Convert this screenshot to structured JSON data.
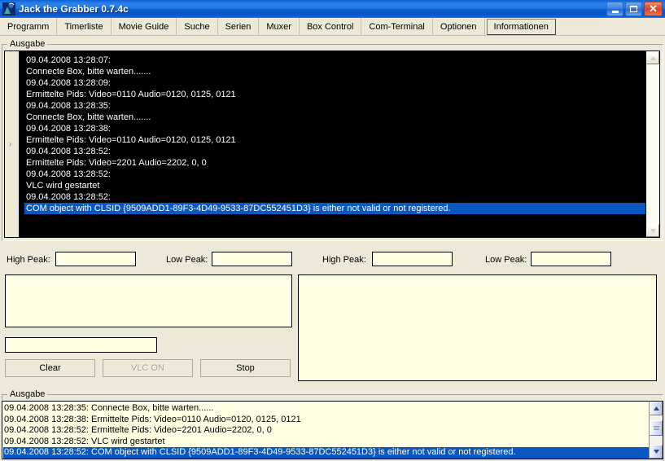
{
  "window": {
    "title": "Jack the Grabber 0.7.4c",
    "icon": "app-icon",
    "caption_buttons": [
      {
        "name": "minimize",
        "glyph": "minimize-icon"
      },
      {
        "name": "maximize",
        "glyph": "maximize-icon"
      },
      {
        "name": "close",
        "glyph": "close-icon",
        "label": "✕"
      }
    ]
  },
  "menu": {
    "items": [
      {
        "label": "Programm",
        "selected": false
      },
      {
        "label": "Timerliste",
        "selected": false
      },
      {
        "label": "Movie Guide",
        "selected": false
      },
      {
        "label": "Suche",
        "selected": false
      },
      {
        "label": "Serien",
        "selected": false
      },
      {
        "label": "Muxer",
        "selected": false
      },
      {
        "label": "Box Control",
        "selected": false
      },
      {
        "label": "Com-Terminal",
        "selected": false
      },
      {
        "label": "Optionen",
        "selected": false
      },
      {
        "label": "Informationen",
        "selected": true
      }
    ]
  },
  "console_group": {
    "label": "Ausgabe",
    "gutter_marker": "›",
    "lines": [
      {
        "text": "09.04.2008 13:28:07:",
        "selected": false
      },
      {
        "text": "Connecte Box, bitte warten.......",
        "selected": false
      },
      {
        "text": "09.04.2008 13:28:09:",
        "selected": false
      },
      {
        "text": "Ermittelte Pids: Video=0110 Audio=0120, 0125, 0121",
        "selected": false
      },
      {
        "text": "09.04.2008 13:28:35:",
        "selected": false
      },
      {
        "text": "Connecte Box, bitte warten.......",
        "selected": false
      },
      {
        "text": "09.04.2008 13:28:38:",
        "selected": false
      },
      {
        "text": "Ermittelte Pids: Video=0110 Audio=0120, 0125, 0121",
        "selected": false
      },
      {
        "text": "09.04.2008 13:28:52:",
        "selected": false
      },
      {
        "text": "Ermittelte Pids: Video=2201 Audio=2202, 0, 0",
        "selected": false
      },
      {
        "text": "09.04.2008 13:28:52:",
        "selected": false
      },
      {
        "text": "VLC wird gestartet",
        "selected": false
      },
      {
        "text": "09.04.2008 13:28:52:",
        "selected": false
      },
      {
        "text": "COM object with CLSID {9509ADD1-89F3-4D49-9533-87DC552451D3} is either not valid or not registered.",
        "selected": true
      }
    ]
  },
  "peaks": {
    "left_high_label": "High Peak:",
    "left_high_value": "",
    "left_low_label": "Low Peak:",
    "left_low_value": "",
    "right_high_label": "High Peak:",
    "right_high_value": "",
    "right_low_label": "Low Peak:",
    "right_low_value": ""
  },
  "panels": {
    "left_display_value": "",
    "right_display_value": "",
    "left_input_value": ""
  },
  "buttons": {
    "clear": {
      "label": "Clear",
      "disabled": false
    },
    "vlc_on": {
      "label": "VLC ON",
      "disabled": true
    },
    "stop": {
      "label": "Stop",
      "disabled": false
    }
  },
  "bottom_group": {
    "label": "Ausgabe",
    "lines": [
      {
        "text": "09.04.2008 13:28:35: Connecte Box, bitte warten......",
        "selected": false
      },
      {
        "text": "09.04.2008 13:28:38: Ermittelte Pids: Video=0110 Audio=0120, 0125, 0121",
        "selected": false
      },
      {
        "text": "09.04.2008 13:28:52: Ermittelte Pids: Video=2201 Audio=2202, 0, 0",
        "selected": false
      },
      {
        "text": "09.04.2008 13:28:52: VLC wird gestartet",
        "selected": false
      },
      {
        "text": "09.04.2008 13:28:52: COM object with CLSID {9509ADD1-89F3-4D49-9533-87DC552451D3} is either not valid or not registered.",
        "selected": true
      }
    ]
  },
  "colors": {
    "titlebar_blue": "#1c74e5",
    "face": "#ece9d8",
    "console_bg": "#000000",
    "ivory": "#ffffe4",
    "selection": "#0a57c2"
  }
}
